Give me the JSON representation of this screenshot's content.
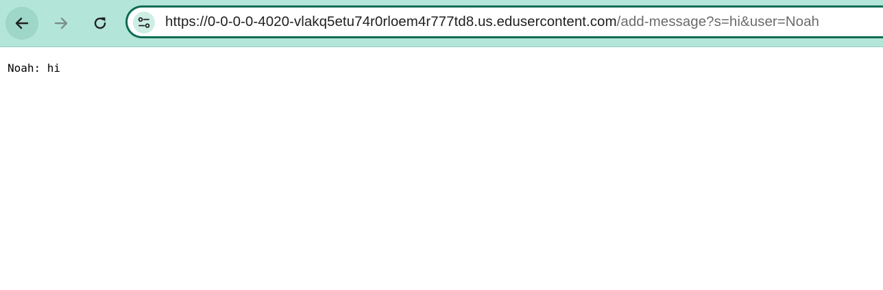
{
  "browser": {
    "url_host": "https://0-0-0-0-4020-vlakq5etu74r0rloem4r777td8.us.edusercontent.com",
    "url_path": "/add-message?s=hi&user=Noah",
    "icons": {
      "back": "arrow-left-icon",
      "forward": "arrow-right-icon",
      "reload": "reload-icon",
      "site_info": "tune-icon"
    }
  },
  "page": {
    "message": "Noah: hi"
  }
}
